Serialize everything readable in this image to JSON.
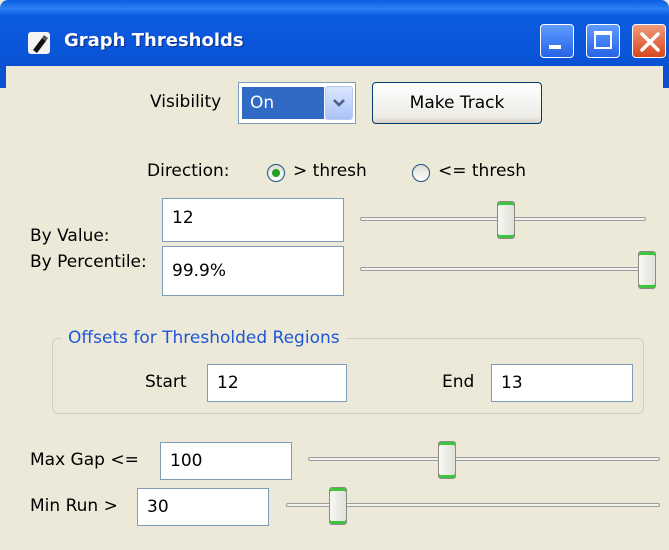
{
  "window": {
    "title": "Graph Thresholds"
  },
  "visibility": {
    "label": "Visibility",
    "value": "On"
  },
  "make_track_label": "Make Track",
  "direction": {
    "label": "Direction:",
    "option_gt": "> thresh",
    "option_le": "<= thresh",
    "selected": "> thresh"
  },
  "by_value": {
    "label": "By Value:",
    "value": "12",
    "slider_fraction": 0.51
  },
  "by_percentile": {
    "label": "By Percentile:",
    "value": "99.9%",
    "slider_fraction": 1.0
  },
  "offsets": {
    "title": "Offsets for Thresholded Regions",
    "start_label": "Start",
    "start_value": "12",
    "end_label": "End",
    "end_value": "13"
  },
  "max_gap": {
    "label": "Max Gap <=",
    "value": "100",
    "slider_fraction": 0.39
  },
  "min_run": {
    "label": "Min Run >",
    "value": "30",
    "slider_fraction": 0.12
  },
  "icons": {
    "app": "wand-icon",
    "minimize": "minimize-icon",
    "maximize": "maximize-icon",
    "close": "close-icon",
    "dropdown": "chevron-down-icon"
  }
}
